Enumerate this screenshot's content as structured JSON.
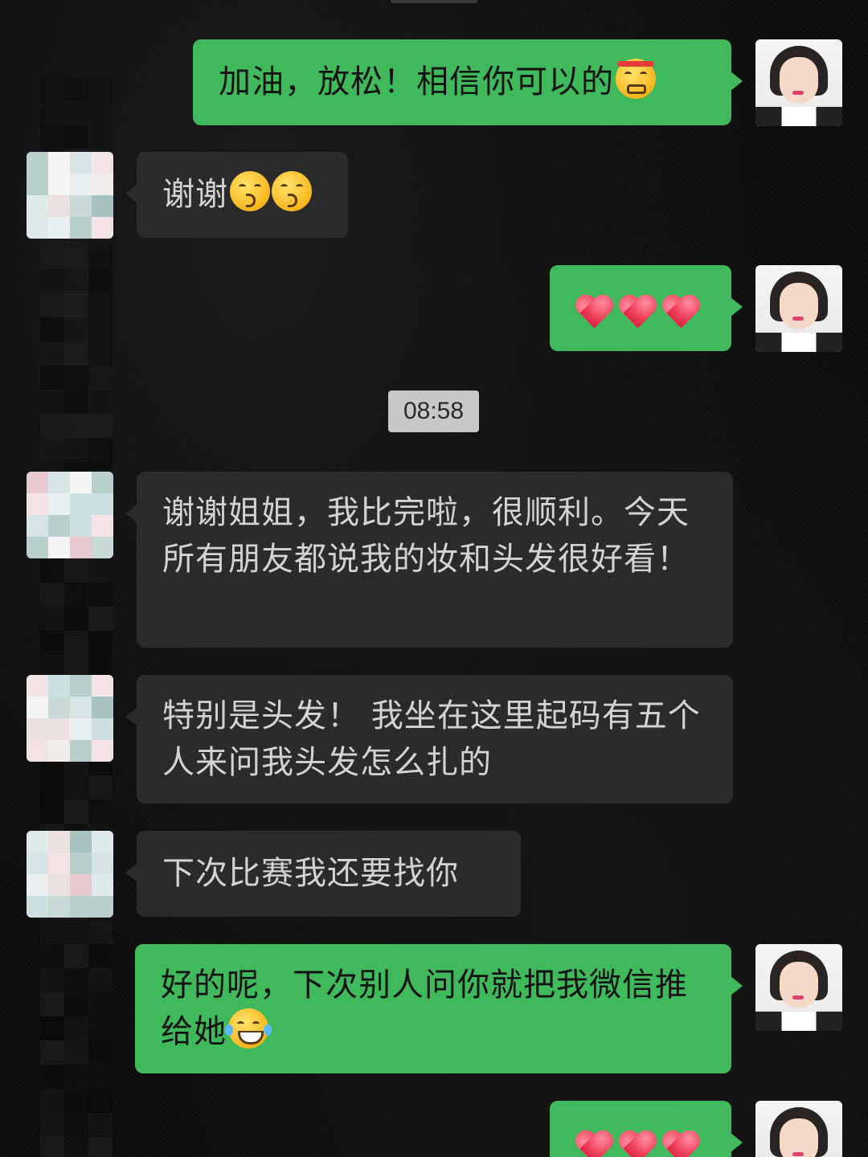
{
  "chat": {
    "timestamp": "08:58",
    "messages": [
      {
        "id": 1,
        "side": "out",
        "text": "加油，放松！相信你可以的",
        "emoji": "determined-face-icon"
      },
      {
        "id": 2,
        "side": "in",
        "text": "谢谢",
        "emoji": "kissing-face-icon"
      },
      {
        "id": 3,
        "side": "out",
        "emoji": "red-heart-icon"
      },
      {
        "id": 4,
        "side": "in",
        "text": "谢谢姐姐，我比完啦，很顺利。今天所有朋友都说我的妆和头发很好看！"
      },
      {
        "id": 5,
        "side": "in",
        "text": "特别是头发！ 我坐在这里起码有五个人来问我头发怎么扎的"
      },
      {
        "id": 6,
        "side": "in",
        "text": "下次比赛我还要找你"
      },
      {
        "id": 7,
        "side": "out",
        "text": "好的呢，下次别人问你就把我微信推给她",
        "emoji": "tears-of-joy-icon"
      },
      {
        "id": 8,
        "side": "out",
        "emoji": "red-heart-icon"
      }
    ]
  },
  "colors": {
    "outgoing_bubble": "#40b95c",
    "incoming_bubble": "#2b2b2b",
    "incoming_text": "#d3d3d3",
    "timestamp_pill": "#c8c8c8"
  }
}
